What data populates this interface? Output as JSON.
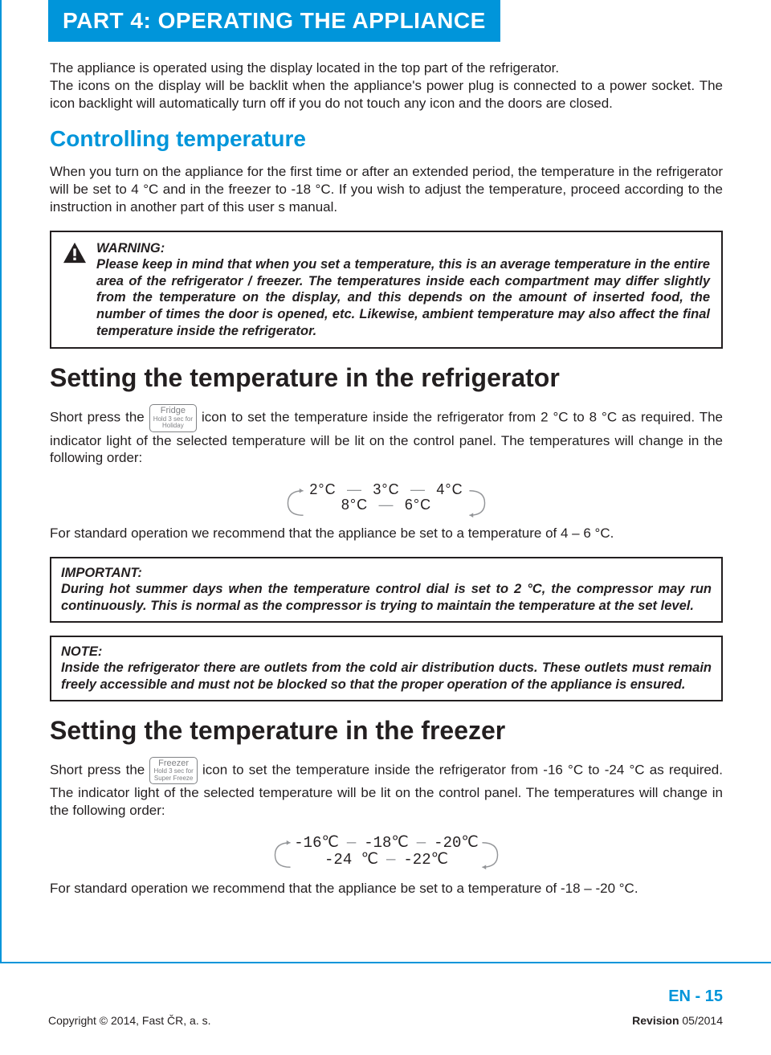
{
  "header": {
    "title": "PART 4: OPERATING THE APPLIANCE"
  },
  "intro": "The appliance is operated using the display located in the top part of the refrigerator.\nThe icons on the display will be backlit when the appliance's power plug is connected to a power socket. The icon backlight will automatically turn off if you do not touch any icon and the doors are closed.",
  "section1": {
    "title": "Controlling temperature",
    "p1": "When you turn on the appliance for the first time or after an extended period, the temperature in the refrigerator will be set to 4 °C and in the freezer to -18 °C. If you wish to adjust the temperature, proceed according to the instruction in another part of this user s manual."
  },
  "warning": {
    "label": "WARNING:",
    "text": "Please keep in mind that when you set a temperature, this is an average temperature in the entire area of the refrigerator / freezer. The temperatures inside each compartment may differ slightly from the temperature on the display, and this depends on the amount of inserted food, the number of times the door is opened, etc. Likewise, ambient temperature may also affect the final temperature inside the refrigerator."
  },
  "section2": {
    "title": "Setting the temperature in the refrigerator",
    "pre": "Short press the ",
    "button": {
      "l1": "Fridge",
      "l2": "Hold 3 sec for",
      "l3": "Holiday"
    },
    "post": " icon to set the temperature inside the refrigerator from 2 °C to 8 °C as required. The indicator light of the selected temperature will be lit on the control panel. The temperatures will change in the following order:",
    "cycle_top": [
      "2°C",
      "3°C",
      "4°C"
    ],
    "cycle_bot": [
      "8°C",
      "6°C"
    ],
    "after": "For standard operation we recommend that the appliance be set to a temperature of 4 – 6 °C."
  },
  "important": {
    "label": "IMPORTANT:",
    "text": "During hot summer days when the temperature control dial is set to 2 °C, the compressor may run continuously. This is normal as the compressor is trying to maintain the temperature at the set level."
  },
  "note": {
    "label": "NOTE:",
    "text": "Inside the refrigerator there are outlets from the cold air distribution ducts. These outlets must remain freely accessible and must not be blocked so that the proper operation of the appliance is ensured."
  },
  "section3": {
    "title": "Setting the temperature in the freezer",
    "pre": "Short press the ",
    "button": {
      "l1": "Freezer",
      "l2": "Hold 3 sec for",
      "l3": "Super Freeze"
    },
    "post": " icon to set the temperature inside the refrigerator from -16 °C to -24 °C as required. The indicator light of the selected temperature will be lit on the control panel. The temperatures will change in the following order:",
    "cycle_top": [
      "-16℃",
      "-18℃",
      "-20℃"
    ],
    "cycle_bot": [
      "-24 ℃",
      "-22℃"
    ],
    "after": "For standard operation we recommend that the appliance be set to a temperature of -18 – -20 °C."
  },
  "footer": {
    "pagenum": "EN - 15",
    "copyright": "Copyright © 2014, Fast ČR, a. s.",
    "revision_label": "Revision",
    "revision_value": " 05/2014"
  }
}
